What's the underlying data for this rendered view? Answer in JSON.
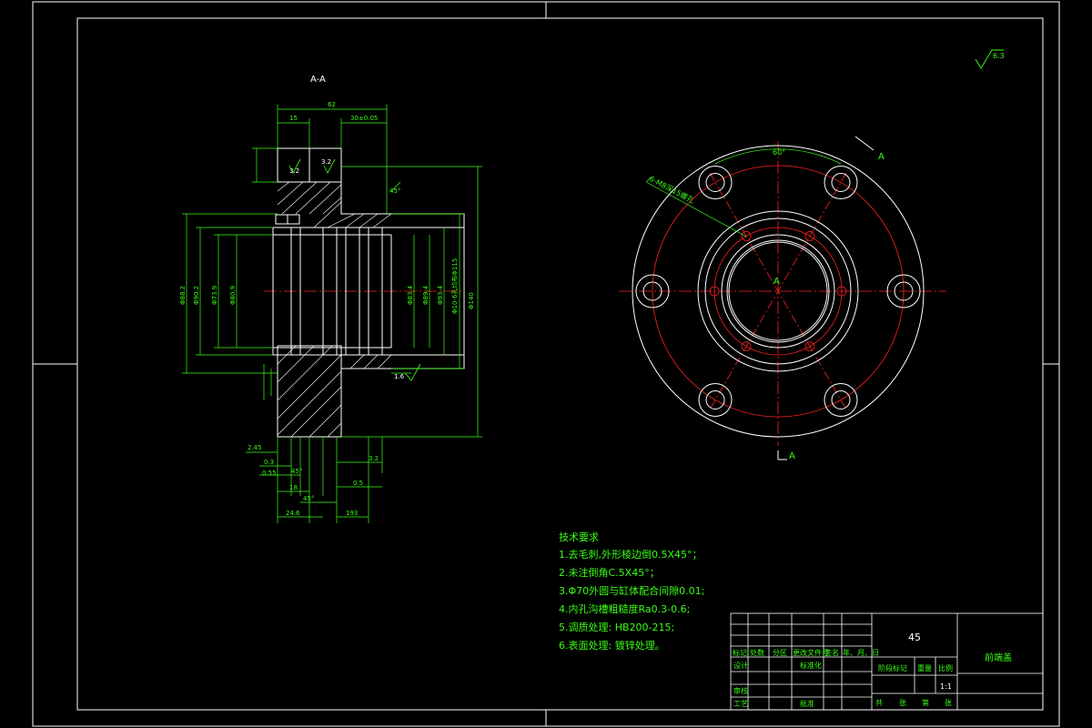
{
  "drawing": {
    "section_label": "A-A",
    "roughness_general": "6.3",
    "view_marker_top": "A",
    "view_marker_center": "A",
    "view_marker_bottom": "A",
    "angle_label": "60°",
    "hole_note": "6-M8深15螺孔"
  },
  "dimensions": {
    "overall_length": "62",
    "flange_thickness": "15",
    "right_length": "30±0.05",
    "roughness_1": "3.2",
    "roughness_2": "3.2",
    "roughness_3": "1.6",
    "left_length": "2.45",
    "d1": "0.3",
    "d2": "0.55",
    "d3": "18",
    "d4": "24.6",
    "d5": "193",
    "d6": "3.2",
    "d7": "0.5",
    "diameter_outer": "Φ140",
    "bolt_circle": "Φ10-6孔均布Φ115",
    "bore_1": "Φ88.2",
    "bore_2": "Φ90.2",
    "bore_3": "Φ73.9",
    "bore_4": "Φ80.9",
    "bore_r1": "Φ83.4",
    "bore_r2": "Φ89.4",
    "bore_r3": "Φ93.4",
    "angle_1": "45°",
    "angle_2": "45°",
    "angle_3": "45°"
  },
  "tech_requirements": {
    "title": "技术要求",
    "items": [
      "1.去毛刺,外形棱边倒0.5X45°；",
      "2.未注倒角C.5X45°；",
      "3.Φ70外圆与缸体配合间隙0.01;",
      "4.内孔沟槽粗糙度Ra0.3-0.6;",
      "5.调质处理: HB200-215;",
      "6.表面处理: 镀锌处理。"
    ]
  },
  "title_block": {
    "material": "45",
    "part_name": "前端盖",
    "scale_label": "比例",
    "scale_value": "1:1",
    "stage_label": "阶段标记",
    "weight_label": "重量",
    "row_labels": [
      "标记",
      "处数",
      "分区",
      "更改文件号",
      "签名",
      "年、月、日"
    ],
    "design_label": "设计",
    "standard_label": "标准化",
    "check_label": "审核",
    "process_label": "工艺",
    "approve_label": "批准",
    "sheet_labels": [
      "共",
      "张",
      "第",
      "张"
    ]
  },
  "colors": {
    "border": "#ffffff",
    "dimension": "#39ff14",
    "centerline": "#ff2020",
    "geometry": "#ffffff",
    "hatch": "#ffffff"
  }
}
